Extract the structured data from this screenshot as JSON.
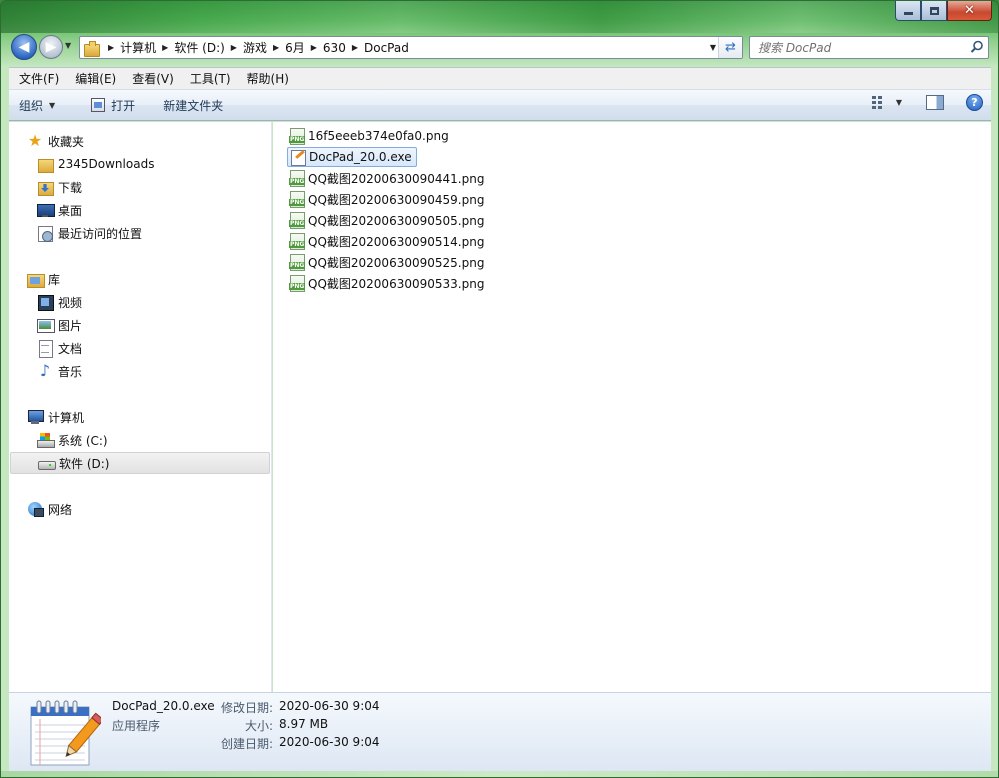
{
  "window": {
    "caption": {
      "minimize": "minimize",
      "maximize": "maximize",
      "close": "close"
    }
  },
  "nav": {
    "breadcrumbs": [
      "计算机",
      "软件 (D:)",
      "游戏",
      "6月",
      "630",
      "DocPad"
    ],
    "search_placeholder": "搜索 DocPad"
  },
  "menu": {
    "items": [
      "文件(F)",
      "编辑(E)",
      "查看(V)",
      "工具(T)",
      "帮助(H)"
    ]
  },
  "commands": {
    "organize": "组织",
    "open": "打开",
    "new_folder": "新建文件夹"
  },
  "sidebar": {
    "favorites": {
      "header": "收藏夹",
      "items": [
        {
          "label": "2345Downloads",
          "icon": "folder-icon"
        },
        {
          "label": "下载",
          "icon": "download-folder-icon"
        },
        {
          "label": "桌面",
          "icon": "desktop-icon"
        },
        {
          "label": "最近访问的位置",
          "icon": "recent-places-icon"
        }
      ]
    },
    "libraries": {
      "header": "库",
      "items": [
        {
          "label": "视频",
          "icon": "video-icon"
        },
        {
          "label": "图片",
          "icon": "picture-icon"
        },
        {
          "label": "文档",
          "icon": "document-icon"
        },
        {
          "label": "音乐",
          "icon": "music-icon"
        }
      ]
    },
    "computer": {
      "header": "计算机",
      "items": [
        {
          "label": "系统 (C:)",
          "icon": "system-drive-icon"
        },
        {
          "label": "软件 (D:)",
          "icon": "drive-icon",
          "selected": true
        }
      ]
    },
    "network": {
      "header": "网络"
    }
  },
  "files": [
    {
      "name": "16f5eeeb374e0fa0.png",
      "type": "png"
    },
    {
      "name": "DocPad_20.0.exe",
      "type": "exe",
      "selected": true
    },
    {
      "name": "QQ截图20200630090441.png",
      "type": "png"
    },
    {
      "name": "QQ截图20200630090459.png",
      "type": "png"
    },
    {
      "name": "QQ截图20200630090505.png",
      "type": "png"
    },
    {
      "name": "QQ截图20200630090514.png",
      "type": "png"
    },
    {
      "name": "QQ截图20200630090525.png",
      "type": "png"
    },
    {
      "name": "QQ截图20200630090533.png",
      "type": "png"
    }
  ],
  "details": {
    "name": "DocPad_20.0.exe",
    "type": "应用程序",
    "modified_label": "修改日期:",
    "modified_value": "2020-06-30 9:04",
    "size_label": "大小:",
    "size_value": "8.97 MB",
    "created_label": "创建日期:",
    "created_value": "2020-06-30 9:04"
  }
}
